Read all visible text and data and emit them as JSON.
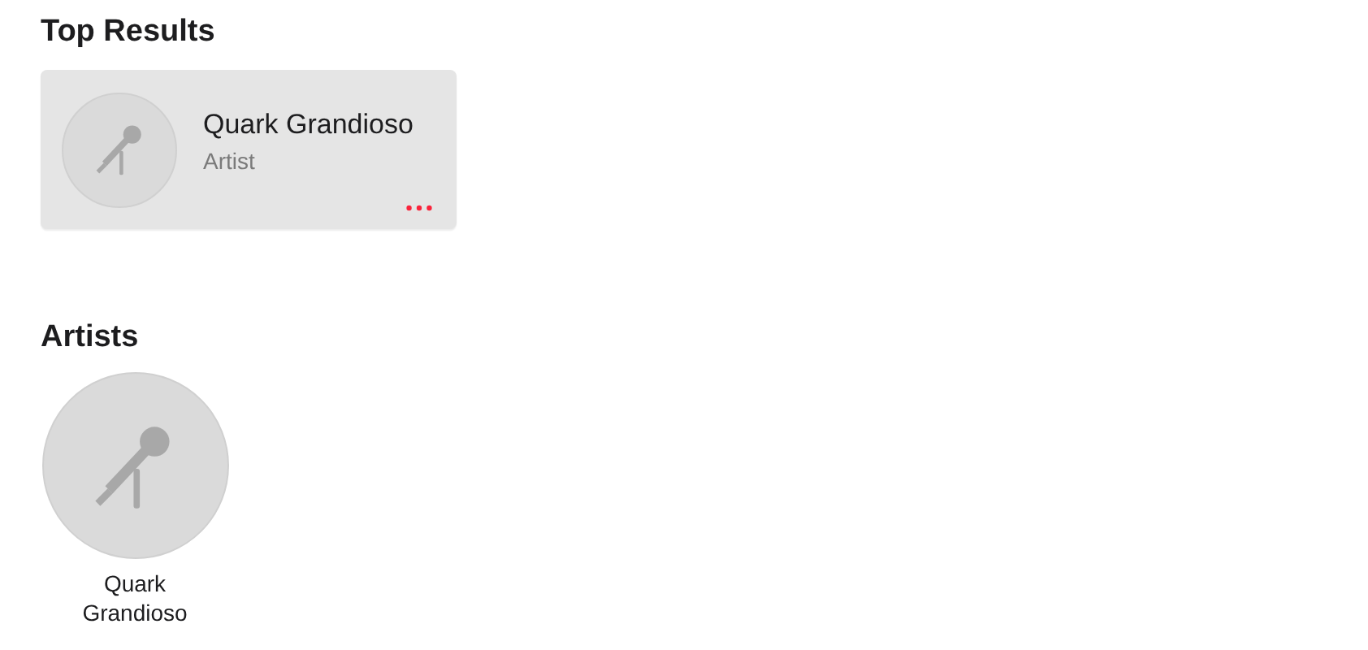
{
  "top_results": {
    "title": "Top Results",
    "items": [
      {
        "name": "Quark Grandioso",
        "type": "Artist"
      }
    ]
  },
  "artists": {
    "title": "Artists",
    "items": [
      {
        "name": "Quark Grandioso"
      }
    ]
  }
}
